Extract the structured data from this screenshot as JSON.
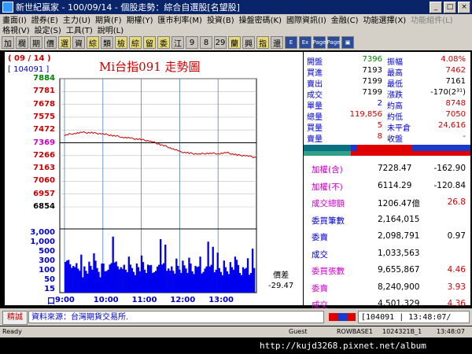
{
  "window": {
    "title": "新世紀贏家 - 100/09/14 - 個股走勢：綜合自選股[名望股]"
  },
  "menu_row1": [
    {
      "label": "畫面(I)",
      "enabled": true
    },
    {
      "label": "證券(E)",
      "enabled": true
    },
    {
      "label": "主力(U)",
      "enabled": true
    },
    {
      "label": "期貨(F)",
      "enabled": true
    },
    {
      "label": "期權(Y)",
      "enabled": true
    },
    {
      "label": "匯市利率(M)",
      "enabled": true
    },
    {
      "label": "投資(B)",
      "enabled": true
    },
    {
      "label": "操盤密碼(K)",
      "enabled": true
    },
    {
      "label": "國際資訊(I)",
      "enabled": true
    },
    {
      "label": "金融(C)",
      "enabled": true
    },
    {
      "label": "功能選擇(X)",
      "enabled": true
    },
    {
      "label": "功能組件(L)",
      "enabled": false
    }
  ],
  "menu_row2": [
    "格視(V)",
    "設定(S)",
    "工具(T)",
    "說明(L)"
  ],
  "toolbar": [
    "加",
    "欄",
    "期",
    "價",
    "選",
    "資",
    "綜",
    "類",
    "檢",
    "綜",
    "留",
    "委",
    "江",
    "9",
    "8",
    "29",
    "蘭",
    "興",
    "指",
    "還",
    "E",
    "Ex",
    "Page Up",
    "Page Down",
    "icon"
  ],
  "chart": {
    "date": "( 09 / 14 )",
    "code": "[ 104091 ]",
    "title": "Mi台指091  走勢圖",
    "price_levels": [
      "7884",
      "7781",
      "7678",
      "7575",
      "7472",
      "7369",
      "7266",
      "7163",
      "7060",
      "6957",
      "6854"
    ],
    "volume_levels": [
      "3,000",
      "1,000",
      "500",
      "300",
      "100",
      "50",
      "15",
      "口"
    ],
    "time_labels": [
      "9:00",
      "10:00",
      "11:00",
      "12:00",
      "13:00"
    ],
    "diff_label": "價差",
    "diff_value": "-29.47",
    "colors": {
      "up": "#cc0000",
      "down": "#008000",
      "volume": "#0000ee",
      "reference": "#000000"
    }
  },
  "chart_data": {
    "type": "line",
    "title": "Mi台指091  走勢圖",
    "ylim": [
      6854,
      7884
    ],
    "x_minutes": [
      0,
      15,
      30,
      45,
      60,
      75,
      90,
      105,
      120,
      135,
      150,
      165,
      180,
      195,
      210,
      225,
      240,
      255,
      270,
      285,
      300
    ],
    "x_ticks": [
      "9:00",
      "10:00",
      "11:00",
      "12:00",
      "13:00"
    ],
    "series": [
      {
        "values": [
          7430,
          7445,
          7452,
          7448,
          7440,
          7428,
          7415,
          7404,
          7395,
          7380,
          7355,
          7330,
          7298,
          7285,
          7278,
          7285,
          7282,
          7288,
          7270,
          7265,
          7250
        ]
      }
    ],
    "reference": 7369,
    "volume_series": [
      1400,
      1100,
      900,
      1200,
      800,
      700,
      1000,
      900,
      600,
      800,
      1100,
      700,
      900,
      600,
      800,
      1000,
      700,
      900,
      1200,
      800,
      900,
      600,
      700,
      1000,
      800,
      900,
      700,
      600,
      1100,
      900
    ]
  },
  "quote": {
    "rows": [
      {
        "l1": "開盤",
        "v1": "7396",
        "l2": "振幅",
        "v2": "4.08%",
        "c1": "#008000",
        "c2": "#cc0000"
      },
      {
        "l1": "買進",
        "v1": "7193",
        "l2": "最高",
        "v2": "7462",
        "c1": "#000000",
        "c2": "#cc0000"
      },
      {
        "l1": "賣出",
        "v1": "7199",
        "l2": "最低",
        "v2": "7161",
        "c1": "#000000",
        "c2": "#000000"
      },
      {
        "l1": "成交",
        "v1": "7199",
        "l2": "漲跌",
        "v2": "-170(2³¹)",
        "c1": "#000000",
        "c2": "#000000"
      },
      {
        "l1": "單量",
        "v1": "2",
        "l2": "約高",
        "v2": "8748",
        "c1": "#0000cc",
        "c2": "#cc0000"
      },
      {
        "l1": "總量",
        "v1": "119,856",
        "l2": "約低",
        "v2": "7050",
        "c1": "#cc0000",
        "c2": "#cc0000"
      },
      {
        "l1": "買量",
        "v1": "5",
        "l2": "未平倉",
        "v2": "24,616",
        "c1": "#cc0000",
        "c2": "#cc0000"
      },
      {
        "l1": "賣量",
        "v1": "8",
        "l2": "收盤",
        "v2": "-",
        "c1": "#cc0000",
        "c2": "#cc0000"
      }
    ],
    "list": [
      {
        "label": "加權(含)",
        "v1": "7228.47",
        "v2": "-162.90",
        "lc": "#cc00cc",
        "vc": "#000000"
      },
      {
        "label": "加權(不)",
        "v1": "6114.29",
        "v2": "-120.84",
        "lc": "#cc00cc",
        "vc": "#000000"
      },
      {
        "label": "成交總額",
        "v1": "1206.47億",
        "v2": "26.8",
        "lc": "#cc00cc",
        "vc": "#cc0000"
      },
      {
        "label": "委買筆數",
        "v1": "2,164,015",
        "v2": "",
        "lc": "#0000cc",
        "vc": "#000000"
      },
      {
        "label": "委賣",
        "v1": "2,098,791",
        "v2": "0.97",
        "lc": "#0000cc",
        "vc": "#000000"
      },
      {
        "label": "成交",
        "v1": "1,033,563",
        "v2": "",
        "lc": "#0000cc",
        "vc": "#000000"
      },
      {
        "label": "委買張數",
        "v1": "9,655,867",
        "v2": "4.46",
        "lc": "#cc00cc",
        "vc": "#cc0000"
      },
      {
        "label": "委賣",
        "v1": "8,240,900",
        "v2": "3.93",
        "lc": "#cc00cc",
        "vc": "#cc0000"
      },
      {
        "label": "成交",
        "v1": "4,501,329",
        "v2": "4.36",
        "lc": "#cc00cc",
        "vc": "#cc0000"
      }
    ]
  },
  "bottom": {
    "button": "精誠",
    "source": "資料來源：台灣期貨交易所.",
    "code": "[104091",
    "time": "13:48:07/"
  },
  "status": {
    "ready": "Ready",
    "user": "Guest",
    "field1": "ROWBASE1",
    "field2": "1024321B_1",
    "field3": "13:48:07"
  },
  "watermark": "http://kujd3268.pixnet.net/album"
}
